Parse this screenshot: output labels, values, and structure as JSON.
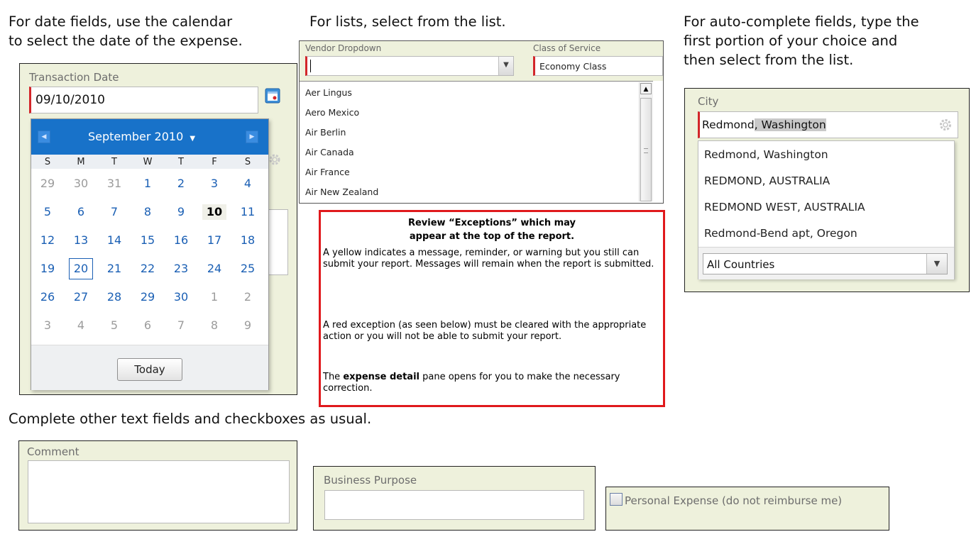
{
  "date_section": {
    "heading_line1": "For date fields, use the calendar",
    "heading_line2": "to select the date of the expense.",
    "field_label": "Transaction Date",
    "field_value": "09/10/2010",
    "calendar": {
      "month_label": "September 2010",
      "weekdays": [
        "S",
        "M",
        "T",
        "W",
        "T",
        "F",
        "S"
      ],
      "weeks": [
        [
          "29",
          "30",
          "31",
          "1",
          "2",
          "3",
          "4"
        ],
        [
          "5",
          "6",
          "7",
          "8",
          "9",
          "10",
          "11"
        ],
        [
          "12",
          "13",
          "14",
          "15",
          "16",
          "17",
          "18"
        ],
        [
          "19",
          "20",
          "21",
          "22",
          "23",
          "24",
          "25"
        ],
        [
          "26",
          "27",
          "28",
          "29",
          "30",
          "1",
          "2"
        ],
        [
          "3",
          "4",
          "5",
          "6",
          "7",
          "8",
          "9"
        ]
      ],
      "selected_day": "10",
      "today_day": "20",
      "today_button": "Today"
    }
  },
  "list_section": {
    "heading": "For lists, select from the list.",
    "vendor_label": "Vendor Dropdown",
    "class_label": "Class of Service",
    "class_value": "Economy Class",
    "vendors": [
      "Aer Lingus",
      "Aero Mexico",
      "Air Berlin",
      "Air Canada",
      "Air France",
      "Air New Zealand"
    ]
  },
  "exceptions_note": {
    "title_line1": "Review “Exceptions” which may",
    "title_line2": "appear at the top of the report.",
    "para1": "A yellow indicates a message, reminder, or warning but you still can submit your report. Messages will remain when the report is submitted.",
    "para2": "A red exception (as seen below) must be cleared with the appropriate action or you will not be able to submit your report.",
    "para3_bold": "expense detail",
    "para3_pre": "The ",
    "para3_post": " pane opens for you to make the necessary correction."
  },
  "autocomplete_section": {
    "heading_line1": "For auto-complete fields, type the",
    "heading_line2": "first portion of your choice and",
    "heading_line3": "then select from the list.",
    "field_label": "City",
    "typed_text": "Redmond",
    "suggested_text": ", Washington",
    "suggestions": [
      "Redmond, Washington",
      "REDMOND, AUSTRALIA",
      "REDMOND WEST, AUSTRALIA",
      "Redmond-Bend apt, Oregon"
    ],
    "country_value": "All Countries"
  },
  "other_section": {
    "heading": "Complete other text fields and checkboxes as usual.",
    "comment_label": "Comment",
    "purpose_label": "Business Purpose",
    "personal_label": "Personal Expense (do not reimburse me)"
  },
  "colors": {
    "panel_bg": "#eef1dc",
    "required_bar": "#d3262a",
    "calendar_header": "#1872c9",
    "note_border": "#e0191c"
  }
}
